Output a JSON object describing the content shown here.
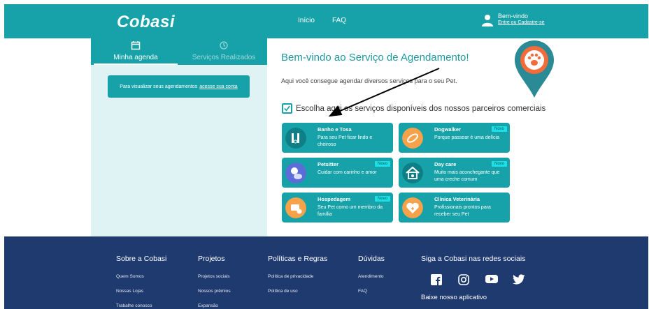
{
  "header": {
    "logo": "Cobasi",
    "nav": {
      "inicio": "Início",
      "faq": "FAQ"
    },
    "welcome": "Bem-vindo",
    "login_link": "Entre ou Cadastre-se"
  },
  "left_panel": {
    "tabs": [
      {
        "label": "Minha agenda",
        "icon": "calendar-icon",
        "active": true
      },
      {
        "label": "Serviços Realizados",
        "icon": "history-icon",
        "active": false
      }
    ],
    "login_prompt": "Para visualizar seus agendamentos",
    "login_prompt_link": "acesse sua conta"
  },
  "main": {
    "headline": "Bem-vindo ao Serviço de Agendamento!",
    "intro": "Aqui você consegue agendar diversos serviços para o seu Pet.",
    "choose": "Escolha aqui os serviços disponíveis dos nossos parceiros comerciais",
    "services": [
      {
        "title": "Banho e Tosa",
        "desc": "Para seu Pet ficar lindo e cheiroso",
        "badge": "",
        "icon": "grooming-icon"
      },
      {
        "title": "Dogwalker",
        "desc": "Porque passear é uma delícia",
        "badge": "Novo",
        "icon": "leash-icon"
      },
      {
        "title": "Petsitter",
        "desc": "Cuidar com carinho e amor",
        "badge": "Novo",
        "icon": "petsitter-icon"
      },
      {
        "title": "Day care",
        "desc": "Muito mais aconchegante que uma creche comum",
        "badge": "Novo",
        "icon": "daycare-house-icon"
      },
      {
        "title": "Hospedagem",
        "desc": "Seu Pet como um membro da família",
        "badge": "Novo",
        "icon": "hosting-icon"
      },
      {
        "title": "Clínica Veterinária",
        "desc": "Profissionais prontos para receber seu Pet",
        "badge": "",
        "icon": "vet-heart-icon"
      }
    ]
  },
  "footer": {
    "columns": [
      {
        "title": "Sobre a Cobasi",
        "links": [
          "Quem Somos",
          "Nossas Lojas",
          "Trabalhe conosco"
        ]
      },
      {
        "title": "Projetos",
        "links": [
          "Projetos sociais",
          "Nossos prêmios",
          "Expansão"
        ]
      },
      {
        "title": "Políticas e Regras",
        "links": [
          "Política de privacidade",
          "Política de uso"
        ]
      },
      {
        "title": "Dúvidas",
        "links": [
          "Atendimento",
          "FAQ"
        ]
      }
    ],
    "social_title": "Siga a Cobasi nas redes sociais",
    "social_icons": [
      "facebook-icon",
      "instagram-icon",
      "youtube-icon",
      "twitter-icon"
    ],
    "app_title": "Baixe nosso aplicativo"
  },
  "colors": {
    "teal": "#16a2a8",
    "panel_bg": "#dff3f5",
    "footer_bg": "#1f3a6e",
    "orange": "#f5a24a",
    "badge": "#1ce0e8"
  }
}
